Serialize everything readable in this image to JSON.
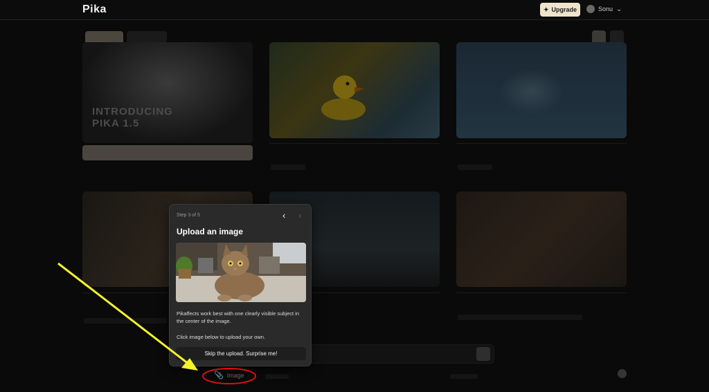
{
  "brand": {
    "logo": "Pika"
  },
  "header": {
    "upgrade_label": "Upgrade",
    "user_name": "Sonu"
  },
  "hero": {
    "title_line1": "INTRODUCING",
    "title_line2": "PIKA 1.5"
  },
  "popover": {
    "step_label": "Step 3 of 5",
    "title": "Upload an image",
    "body": "Pikaffects work best with one clearly visible subject in the center of the image.",
    "instruction": "Click image below to upload your own.",
    "skip_label": "Skip the upload. Surprise me!"
  },
  "prompt_bar": {
    "image_label": "Image"
  },
  "colors": {
    "annotation_arrow": "#f5f52a",
    "annotation_circle": "#e01010",
    "upgrade_bg": "#efe3cc"
  },
  "icons": {
    "upgrade": "sparkle-icon",
    "user": "user-avatar-icon",
    "dropdown": "chevron-down-icon",
    "prev": "chevron-left-icon",
    "next": "chevron-right-icon",
    "attach": "paperclip-icon"
  }
}
